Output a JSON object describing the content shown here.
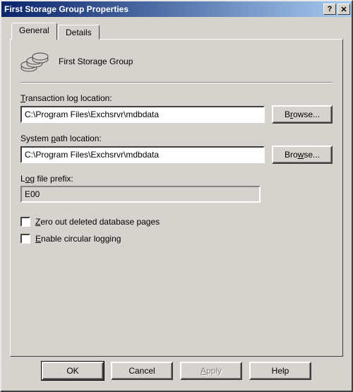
{
  "window": {
    "title": "First Storage Group Properties",
    "help_btn": "?",
    "close_btn": "✕"
  },
  "tabs": {
    "general": "General",
    "details": "Details"
  },
  "header": {
    "name": "First Storage Group"
  },
  "fields": {
    "txlog_label_pre": "T",
    "txlog_label_post": "ransaction log location:",
    "txlog_value": "C:\\Program Files\\Exchsrvr\\mdbdata",
    "syspath_label_pre": "System ",
    "syspath_label_u": "p",
    "syspath_label_post": "ath location:",
    "syspath_value": "C:\\Program Files\\Exchsrvr\\mdbdata",
    "prefix_label_pre": "L",
    "prefix_label_u": "o",
    "prefix_label_post": "g file prefix:",
    "prefix_value": "E00",
    "browse1_pre": "B",
    "browse1_u": "r",
    "browse1_post": "owse...",
    "browse2_pre": "Bro",
    "browse2_u": "w",
    "browse2_post": "se..."
  },
  "checks": {
    "zero_u": "Z",
    "zero_post": "ero out deleted database pages",
    "circ_u": "E",
    "circ_post": "nable circular logging"
  },
  "buttons": {
    "ok": "OK",
    "cancel": "Cancel",
    "apply_u": "A",
    "apply_post": "pply",
    "help": "Help"
  }
}
